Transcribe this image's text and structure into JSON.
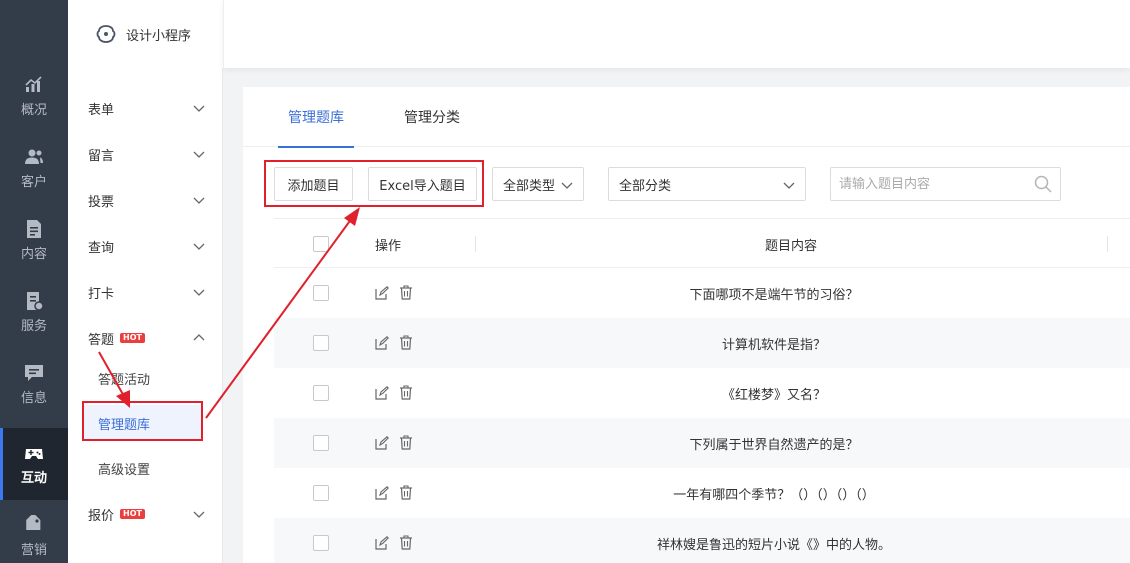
{
  "rail": [
    {
      "label": "概况",
      "icon": "chart-icon"
    },
    {
      "label": "客户",
      "icon": "users-icon"
    },
    {
      "label": "内容",
      "icon": "document-icon"
    },
    {
      "label": "服务",
      "icon": "service-icon"
    },
    {
      "label": "信息",
      "icon": "message-icon"
    },
    {
      "label": "互动",
      "icon": "gamepad-icon",
      "active": true
    },
    {
      "label": "营销",
      "icon": "tag-icon"
    }
  ],
  "brand": {
    "title": "设计小程序"
  },
  "menu": {
    "form": "表单",
    "message": "留言",
    "vote": "投票",
    "query": "查询",
    "checkin": "打卡",
    "quiz": "答题",
    "quiz_badge": "HOT",
    "quiz_sub": [
      "答题活动",
      "管理题库",
      "高级设置"
    ],
    "quote": "报价",
    "quote_badge": "HOT"
  },
  "tabs": {
    "bank": "管理题库",
    "category": "管理分类"
  },
  "toolbar": {
    "add_label": "添加题目",
    "import_label": "Excel导入题目",
    "type_select": "全部类型",
    "category_select": "全部分类",
    "search_placeholder": "请输入题目内容"
  },
  "table": {
    "headers": {
      "action": "操作",
      "content": "题目内容"
    },
    "rows": [
      "下面哪项不是端午节的习俗？",
      "计算机软件是指？",
      "《红楼梦》又名？",
      "下列属于世界自然遗产的是？",
      "一年有哪四个季节？（）（）（）（）",
      "祥林嫂是鲁迅的短片小说《》中的人物。"
    ]
  },
  "colors": {
    "accent": "#3c6fd6",
    "highlight": "#e0212d",
    "rail": "#333c49"
  }
}
